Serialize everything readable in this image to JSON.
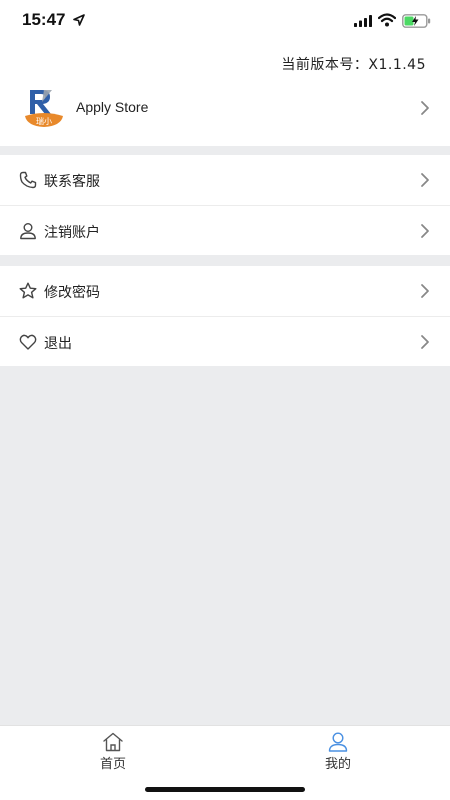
{
  "status_bar": {
    "time": "15:47"
  },
  "header": {
    "version_text": "当前版本号：X1.1.45",
    "app_name": "Apply Store",
    "logo_text": "瑞小"
  },
  "menu_group_1": {
    "items": [
      {
        "label": "联系客服",
        "icon": "phone-icon"
      },
      {
        "label": "注销账户",
        "icon": "user-icon"
      }
    ]
  },
  "menu_group_2": {
    "items": [
      {
        "label": "修改密码",
        "icon": "star-icon"
      },
      {
        "label": "退出",
        "icon": "heart-icon"
      }
    ]
  },
  "tabbar": {
    "tabs": [
      {
        "label": "首页",
        "icon": "home-icon",
        "active": false
      },
      {
        "label": "我的",
        "icon": "person-icon",
        "active": true
      }
    ]
  },
  "colors": {
    "background": "#ebecee",
    "accent": "#4a90e2",
    "logo_orange": "#e8892b",
    "logo_blue": "#2f5fa8"
  }
}
